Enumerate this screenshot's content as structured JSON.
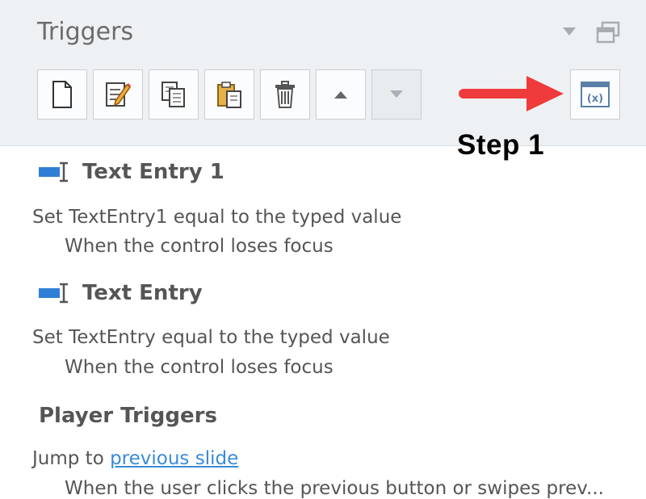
{
  "panel": {
    "title": "Triggers"
  },
  "toolbar": {
    "buttons": [
      {
        "name": "new-trigger",
        "icon": "new-document-icon"
      },
      {
        "name": "edit-trigger",
        "icon": "edit-pencil-icon"
      },
      {
        "name": "copy-trigger",
        "icon": "copy-icon"
      },
      {
        "name": "paste-trigger",
        "icon": "paste-icon"
      },
      {
        "name": "delete-trigger",
        "icon": "trash-icon"
      },
      {
        "name": "move-up",
        "icon": "triangle-up-icon"
      },
      {
        "name": "move-down",
        "icon": "triangle-down-icon",
        "disabled": true
      },
      {
        "name": "manage-variables",
        "icon": "variables-icon"
      }
    ]
  },
  "annotation": {
    "step_label": "Step 1",
    "arrow_color": "#ef3b3b"
  },
  "triggers": [
    {
      "object": "Text Entry 1",
      "action": "Set TextEntry1 equal to the typed value",
      "when": "When the control loses focus"
    },
    {
      "object": "Text Entry",
      "action": "Set TextEntry equal to the typed value",
      "when": "When the control loses focus"
    }
  ],
  "player_triggers": {
    "heading": "Player Triggers",
    "action_prefix": "Jump to ",
    "action_link": "previous slide",
    "when": "When the user clicks the previous button or swipes prev..."
  },
  "colors": {
    "header_bg": "#eef1f4",
    "link": "#3a8bd8",
    "icon_blue": "#2f7fd6"
  }
}
